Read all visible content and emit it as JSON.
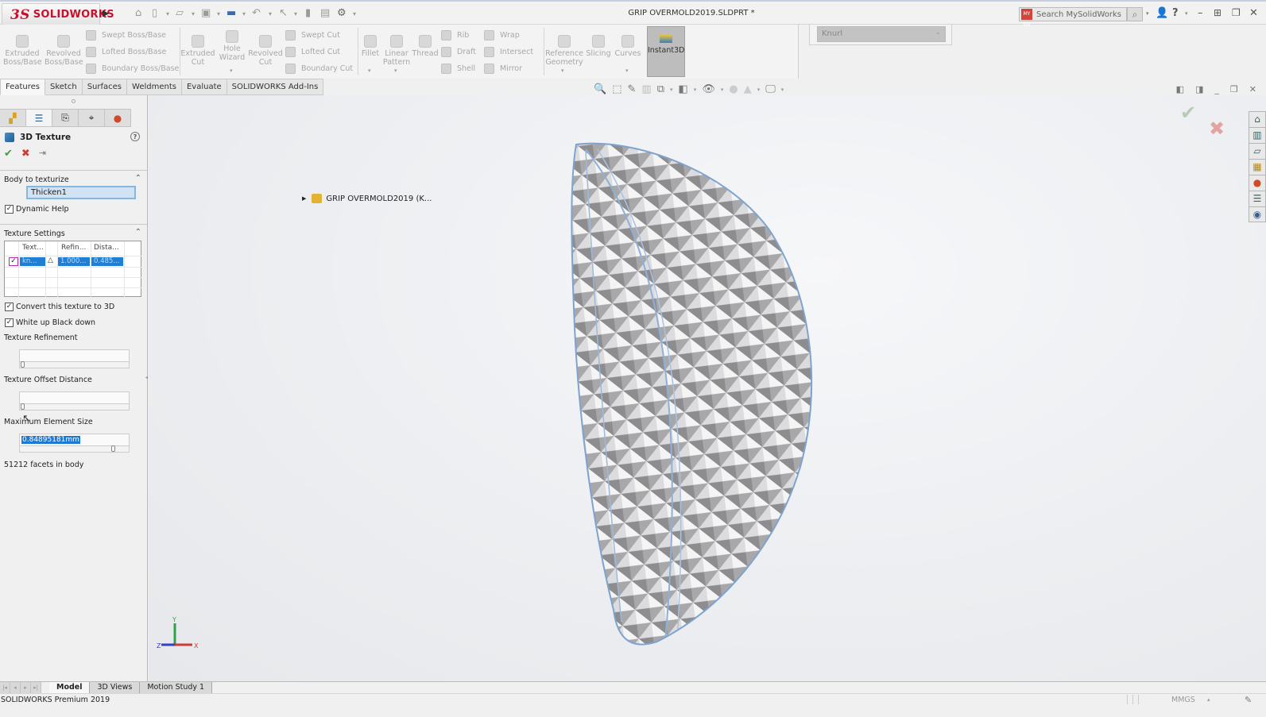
{
  "app": {
    "brand": "SOLIDWORKS",
    "brand_prefix": "3S",
    "document_title": "GRIP OVERMOLD2019.SLDPRT *",
    "search_placeholder": "Search MySolidWorks",
    "search_badge": "MY SW"
  },
  "quick_access": [
    "home-icon",
    "new-document-icon",
    "open-icon",
    "save-icon",
    "print-icon",
    "undo-icon",
    "select-icon",
    "rebuild-icon",
    "file-properties-icon",
    "options-icon"
  ],
  "command_manager": {
    "large_buttons": [
      {
        "label": "Extruded Boss/Base"
      },
      {
        "label": "Revolved Boss/Base"
      },
      {
        "label": "Extruded Cut"
      },
      {
        "label": "Hole Wizard"
      },
      {
        "label": "Revolved Cut"
      },
      {
        "label": "Fillet"
      },
      {
        "label": "Linear Pattern"
      },
      {
        "label": "Thread"
      },
      {
        "label": "Reference Geometry"
      },
      {
        "label": "Slicing"
      },
      {
        "label": "Curves"
      },
      {
        "label": "Instant3D"
      }
    ],
    "small_buttons": [
      {
        "label": "Swept Boss/Base"
      },
      {
        "label": "Lofted Boss/Base"
      },
      {
        "label": "Boundary Boss/Base"
      },
      {
        "label": "Swept Cut"
      },
      {
        "label": "Lofted Cut"
      },
      {
        "label": "Boundary Cut"
      },
      {
        "label": "Rib"
      },
      {
        "label": "Draft"
      },
      {
        "label": "Shell"
      },
      {
        "label": "Wrap"
      },
      {
        "label": "Intersect"
      },
      {
        "label": "Mirror"
      }
    ],
    "tabs": [
      {
        "label": "Features",
        "active": true
      },
      {
        "label": "Sketch"
      },
      {
        "label": "Surfaces"
      },
      {
        "label": "Weldments"
      },
      {
        "label": "Evaluate"
      },
      {
        "label": "SOLIDWORKS Add-Ins"
      }
    ]
  },
  "texture_dropdown": {
    "value": "Knurl"
  },
  "property_manager": {
    "title": "3D Texture",
    "sections": {
      "body": {
        "title": "Body to texturize",
        "value": "Thicken1"
      },
      "dynamic_help": {
        "label": "Dynamic Help",
        "checked": true
      },
      "texture_settings": {
        "title": "Texture Settings",
        "columns": [
          "Text...",
          "Refin...",
          "Dista..."
        ],
        "rows": [
          {
            "checked": true,
            "texture": "kn...",
            "refinement": "1.000...",
            "distance": "0.485..."
          }
        ]
      },
      "convert_3d": {
        "label": "Convert this texture to 3D",
        "checked": true
      },
      "white_up": {
        "label": "White up Black down",
        "checked": true
      },
      "refinement": {
        "label": "Texture Refinement",
        "slider_fraction": 0.0
      },
      "offset": {
        "label": "Texture Offset Distance",
        "slider_fraction": 0.0
      },
      "max_element": {
        "label": "Maximum Element Size",
        "value": "0.84895181mm",
        "slider_fraction": 0.88
      },
      "facets": "51212 facets in body"
    }
  },
  "feature_tree": {
    "root": "GRIP OVERMOLD2019  (K..."
  },
  "viewport": {
    "triad": {
      "x": "X",
      "y": "Y",
      "z": "Z"
    }
  },
  "bottom_tabs": [
    {
      "label": "Model",
      "active": true
    },
    {
      "label": "3D Views"
    },
    {
      "label": "Motion Study 1"
    }
  ],
  "status": {
    "product": "SOLIDWORKS Premium 2019",
    "units": "MMGS"
  }
}
